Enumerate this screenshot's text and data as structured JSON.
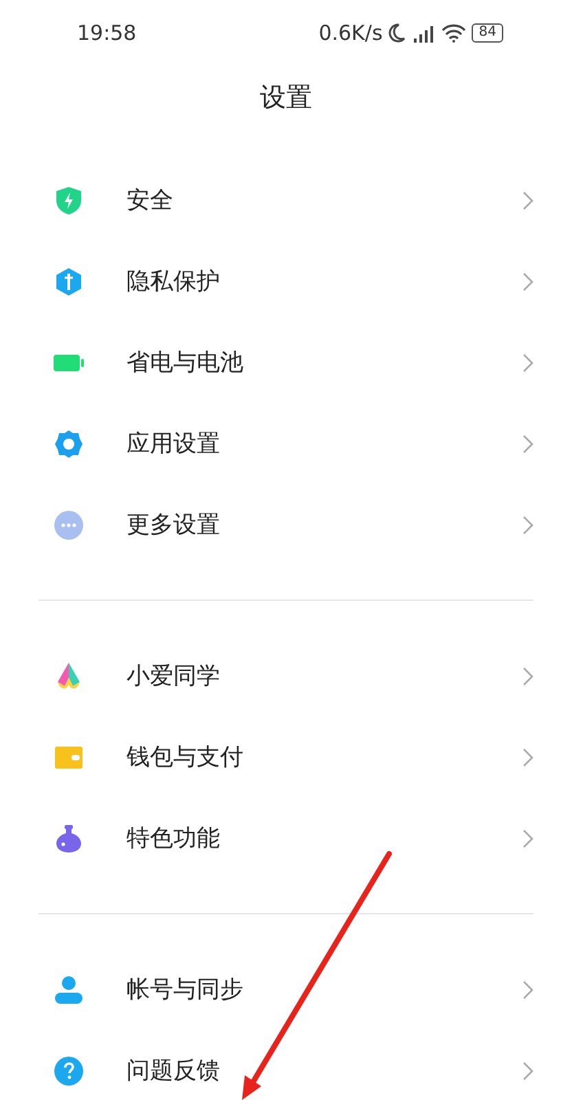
{
  "status_bar": {
    "time": "19:58",
    "net_speed": "0.6K/s",
    "battery": "84"
  },
  "title": "设置",
  "groups": [
    {
      "items": [
        {
          "kind": "shield",
          "label": "安全"
        },
        {
          "kind": "privacy",
          "label": "隐私保护"
        },
        {
          "kind": "battery",
          "label": "省电与电池"
        },
        {
          "kind": "gear",
          "label": "应用设置"
        },
        {
          "kind": "more",
          "label": "更多设置"
        }
      ]
    },
    {
      "items": [
        {
          "kind": "assistant",
          "label": "小爱同学"
        },
        {
          "kind": "wallet",
          "label": "钱包与支付"
        },
        {
          "kind": "flask",
          "label": "特色功能"
        }
      ]
    },
    {
      "items": [
        {
          "kind": "person",
          "label": "帐号与同步"
        },
        {
          "kind": "help",
          "label": "问题反馈"
        }
      ]
    }
  ]
}
